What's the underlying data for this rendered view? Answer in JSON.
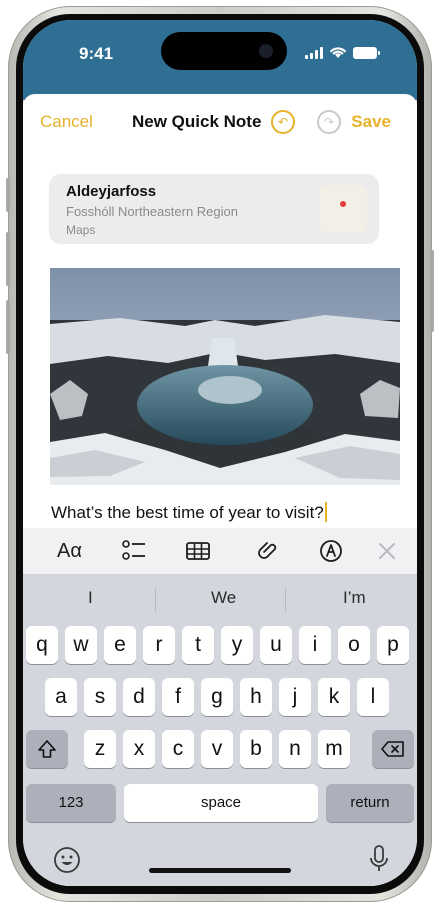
{
  "status_bar": {
    "time": "9:41"
  },
  "nav": {
    "cancel": "Cancel",
    "title": "New Quick Note",
    "undo_icon": "undo-icon",
    "redo_icon": "redo-icon",
    "save": "Save"
  },
  "link_card": {
    "place": "Aldeyjarfoss",
    "region": "Fosshóll Northeastern Region",
    "source": "Maps"
  },
  "note": {
    "text": "What’s the best time of year to visit?"
  },
  "toolbar": {
    "format_label": "Aα",
    "items": [
      "checklist-icon",
      "table-icon",
      "attachment-icon",
      "markup-icon",
      "close-icon"
    ]
  },
  "suggestions": [
    "I",
    "We",
    "I’m"
  ],
  "keyboard": {
    "row1": [
      "q",
      "w",
      "e",
      "r",
      "t",
      "y",
      "u",
      "i",
      "o",
      "p"
    ],
    "row2": [
      "a",
      "s",
      "d",
      "f",
      "g",
      "h",
      "j",
      "k",
      "l"
    ],
    "row3": [
      "z",
      "x",
      "c",
      "v",
      "b",
      "n",
      "m"
    ],
    "numbers": "123",
    "space": "space",
    "return": "return"
  },
  "colors": {
    "accent": "#e7b12b",
    "status_bg": "#2f6f93",
    "keyboard_bg": "#d3d6dc"
  }
}
